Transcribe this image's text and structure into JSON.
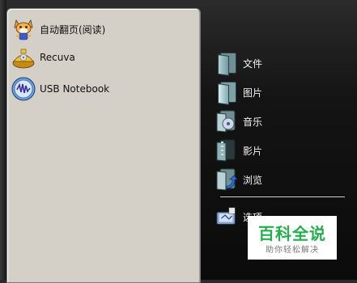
{
  "start_menu": {
    "pinned": [
      {
        "label": "自动翻页(阅读)",
        "icon": "fox-character-icon"
      },
      {
        "label": "Recuva",
        "icon": "recuva-icon"
      },
      {
        "label": "USB Notebook",
        "icon": "usb-notebook-icon"
      }
    ],
    "places": [
      {
        "label": "文件",
        "icon": "folder-documents-icon"
      },
      {
        "label": "图片",
        "icon": "folder-pictures-icon"
      },
      {
        "label": "音乐",
        "icon": "folder-music-icon"
      },
      {
        "label": "影片",
        "icon": "folder-videos-icon"
      },
      {
        "label": "浏览",
        "icon": "folder-browse-icon"
      }
    ],
    "options": {
      "label": "选项",
      "icon": "options-icon"
    }
  },
  "watermark": {
    "title": "百科全说",
    "subtitle": "助你轻松解决"
  },
  "colors": {
    "panel": "#d4d0c8",
    "background": "#111111",
    "watermark_green": "#22b04b"
  }
}
